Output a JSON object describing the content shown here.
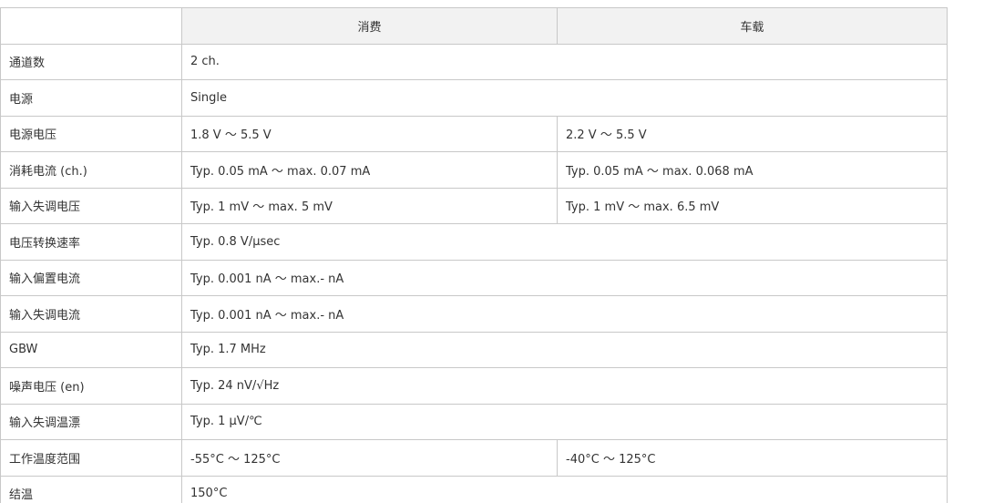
{
  "table": {
    "headers": [
      "消费",
      "车载"
    ],
    "rows": [
      {
        "label": "通道数",
        "consumer": "2 ch."
      },
      {
        "label": "电源",
        "consumer": "Single"
      },
      {
        "label": "电源电压",
        "consumer": "1.8 V ～ 5.5 V",
        "automotive": "2.2 V ～ 5.5 V"
      },
      {
        "label": "消耗电流 (ch.)",
        "consumer": "Typ. 0.05 mA ～ max. 0.07 mA",
        "automotive": "Typ. 0.05 mA ～ max. 0.068 mA"
      },
      {
        "label": "输入失调电压",
        "consumer": "Typ. 1 mV ～ max. 5 mV",
        "automotive": "Typ. 1 mV ～ max. 6.5 mV"
      },
      {
        "label": "电压转换速率",
        "consumer": "Typ. 0.8 V/μsec"
      },
      {
        "label": "输入偏置电流",
        "consumer": "Typ. 0.001 nA ～ max.- nA"
      },
      {
        "label": "输入失调电流",
        "consumer": "Typ. 0.001 nA ～ max.- nA"
      },
      {
        "label": "GBW",
        "consumer": "Typ. 1.7 MHz"
      },
      {
        "label": "噪声电压 (en)",
        "consumer": "Typ. 24 nV/√Hz"
      },
      {
        "label": "输入失调温漂",
        "consumer": "Typ. 1 μV/℃"
      },
      {
        "label": "工作温度范围",
        "consumer": "-55°C ～ 125°C",
        "automotive": "-40°C ～ 125°C"
      },
      {
        "label": "结温",
        "consumer": "150°C"
      }
    ]
  }
}
